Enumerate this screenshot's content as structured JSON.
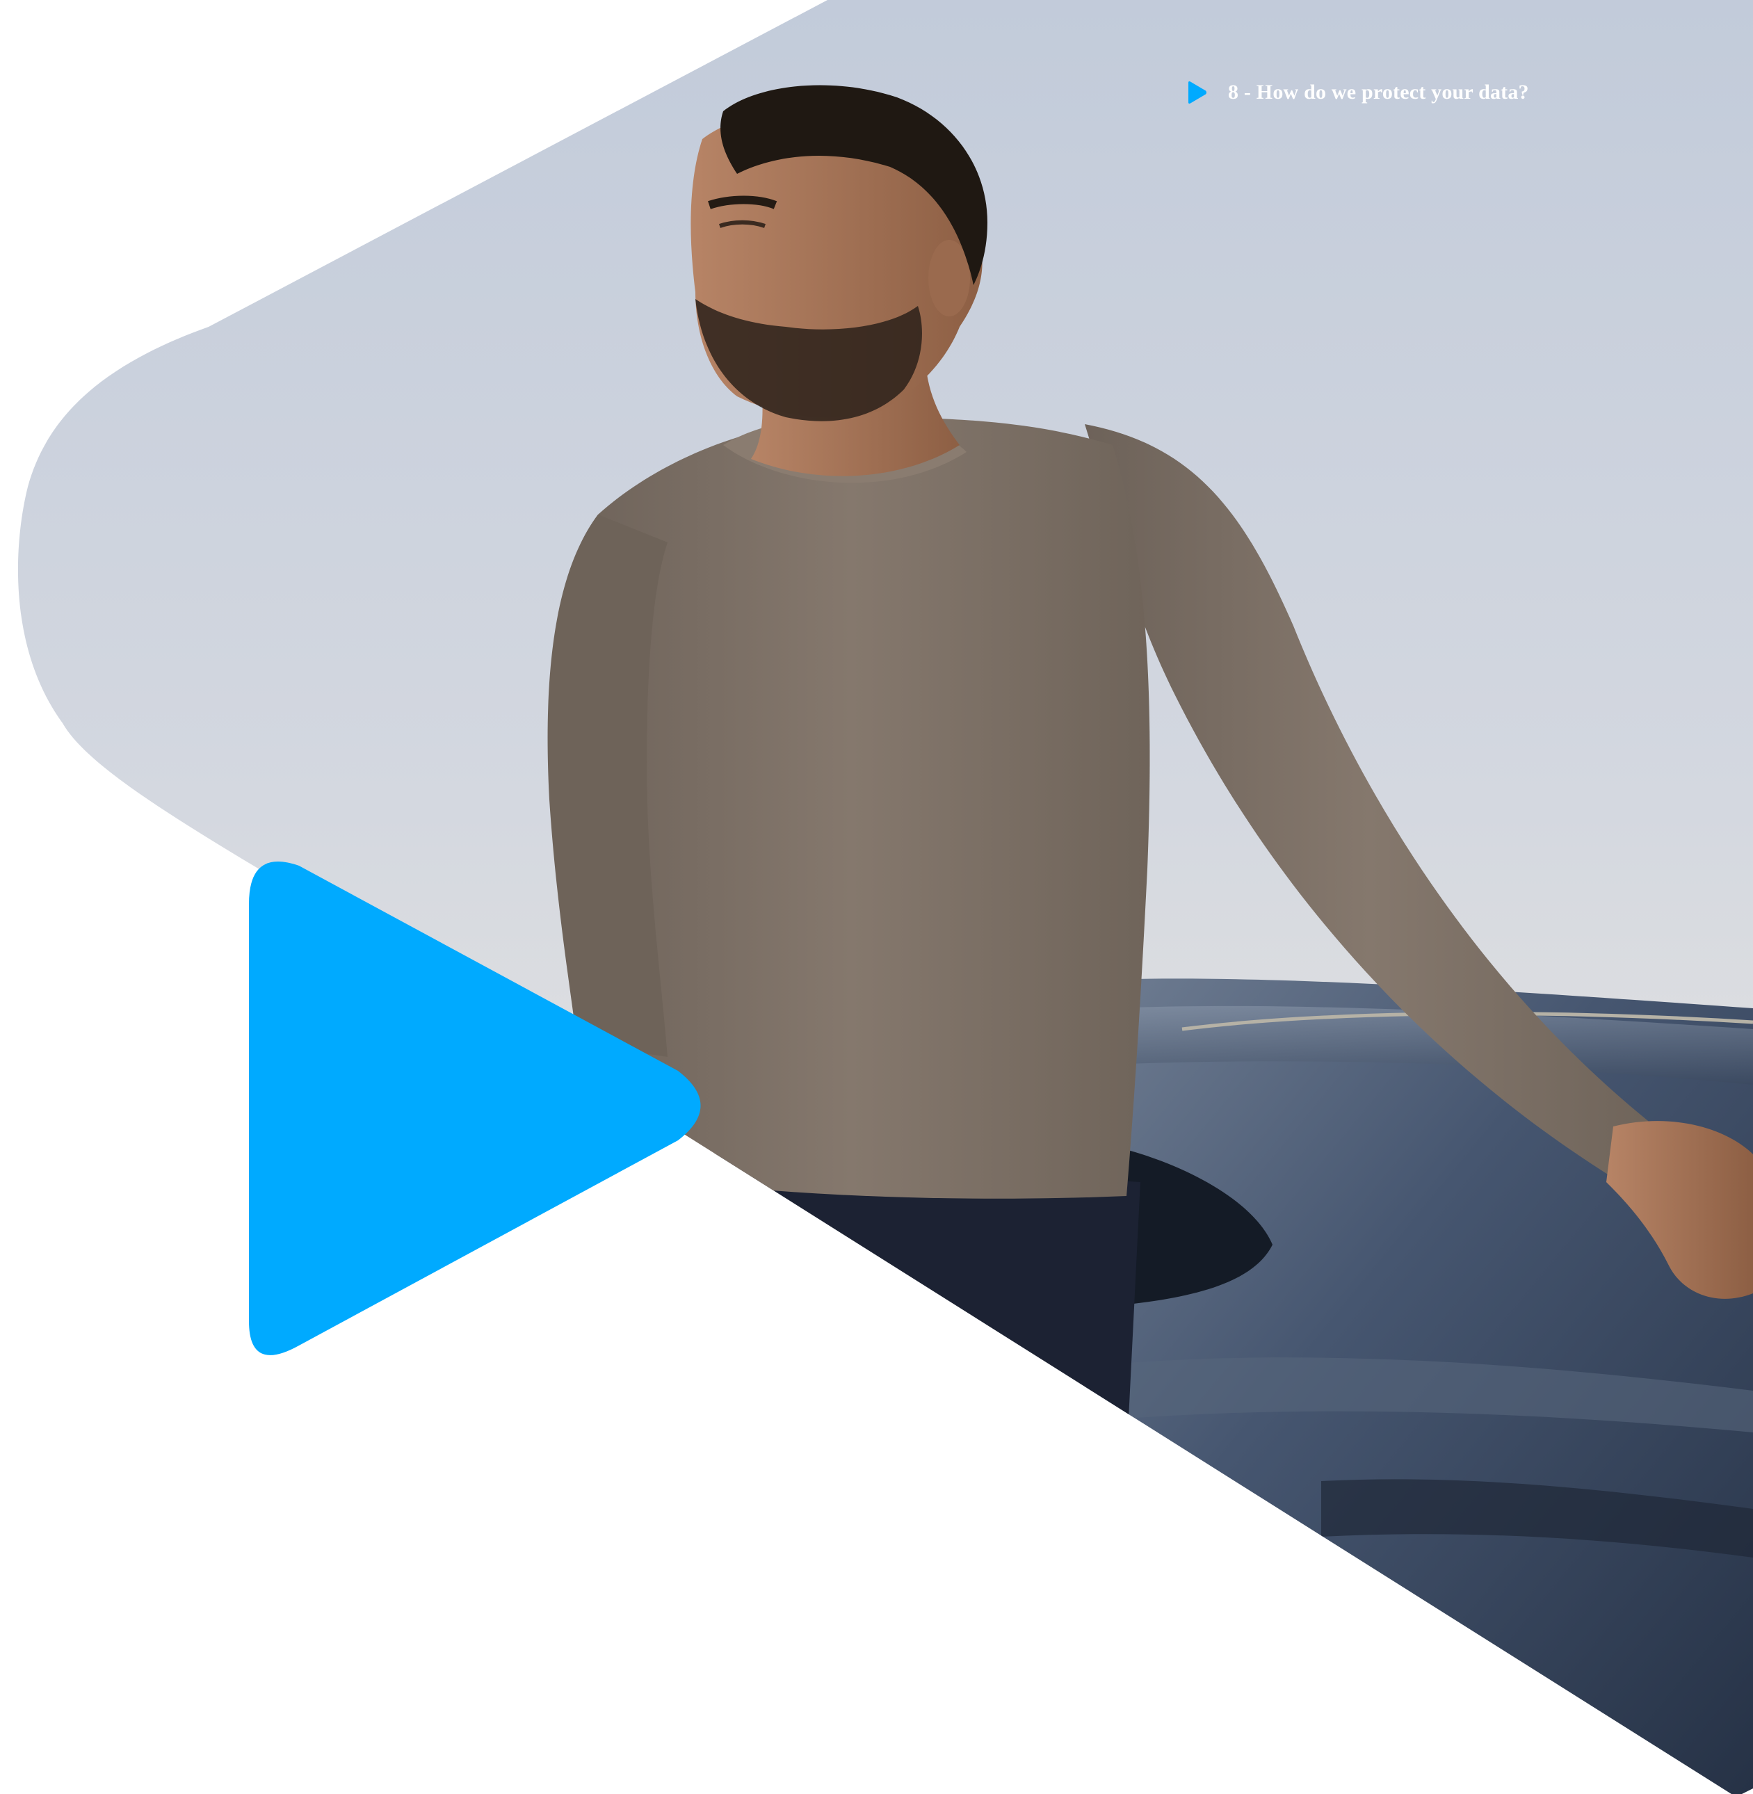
{
  "header": {
    "section_link_label": "8 - How do we protect your data?"
  },
  "colors": {
    "accent": "#00aaff",
    "background": "#ffffff",
    "sky_top": "#c4cddb",
    "sky_bottom": "#e9e6e1",
    "sweater": "#7e7269",
    "car_body": "#3b4a60"
  },
  "icons": {
    "section_marker": "play-triangle-icon",
    "brand_shape": "play-triangle-icon"
  }
}
